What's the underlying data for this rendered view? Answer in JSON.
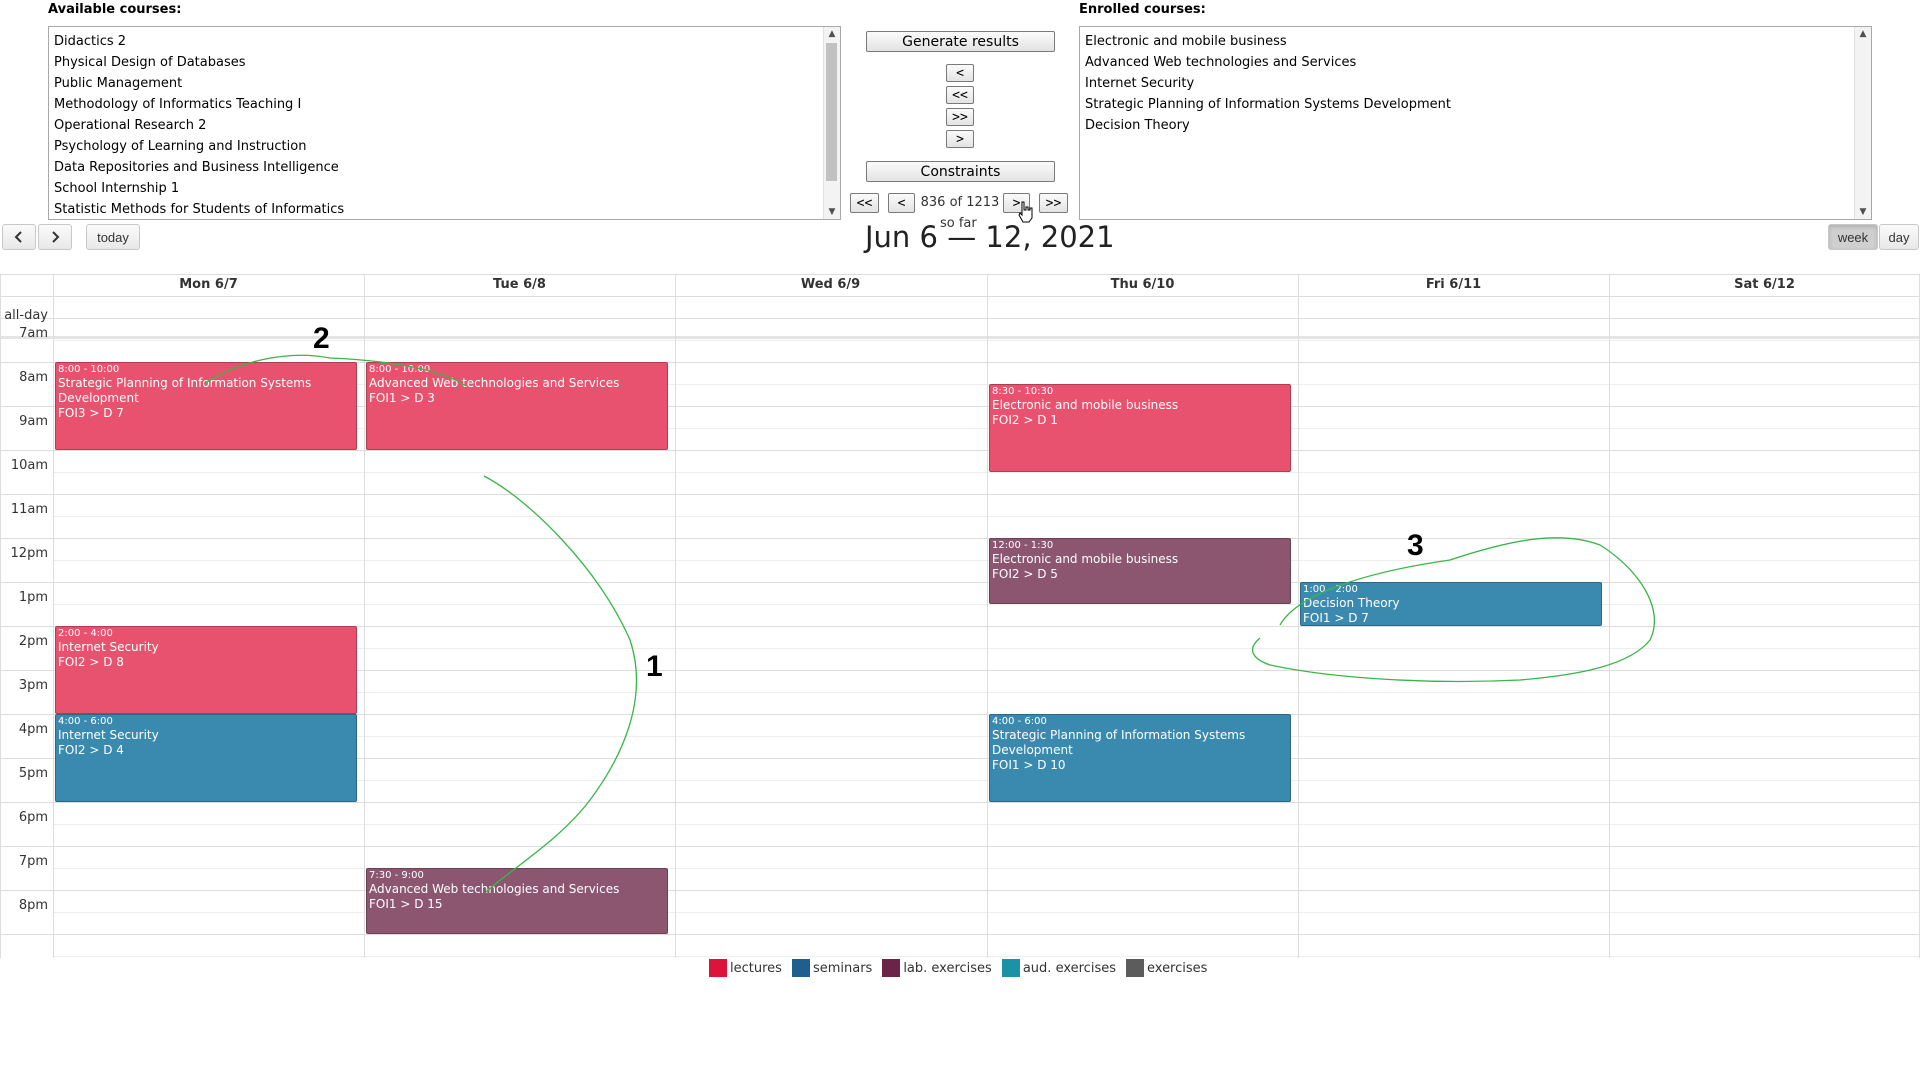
{
  "available": {
    "label": "Available courses:",
    "items": [
      "Didactics 2",
      "Physical Design of Databases",
      "Public Management",
      "Methodology of Informatics Teaching I",
      "Operational Research 2",
      "Psychology of Learning and Instruction",
      "Data Repositories and Business Intelligence",
      "School Internship 1",
      "Statistic Methods for Students of Informatics"
    ]
  },
  "enrolled": {
    "label": "Enrolled courses:",
    "items": [
      "Electronic and mobile business",
      "Advanced Web technologies and Services",
      "Internet Security",
      "Strategic Planning of Information Systems Development",
      "Decision Theory"
    ]
  },
  "controls": {
    "generate": "Generate results",
    "move_left": "<",
    "move_all_left": "<<",
    "move_all_right": ">>",
    "move_right": ">",
    "constraints": "Constraints",
    "first": "<<",
    "prev": "<",
    "counter": "836 of 1213",
    "next": ">",
    "last": ">>",
    "so_far": "so far"
  },
  "toolbar": {
    "prev": "<",
    "next": ">",
    "today": "today",
    "title": "Jun 6 — 12, 2021",
    "week": "week",
    "day": "day"
  },
  "calendar": {
    "days": [
      "Mon 6/7",
      "Tue 6/8",
      "Wed 6/9",
      "Thu 6/10",
      "Fri 6/11",
      "Sat 6/12"
    ],
    "allday": "all-day",
    "times": [
      "7am",
      "8am",
      "9am",
      "10am",
      "11am",
      "12pm",
      "1pm",
      "2pm",
      "3pm",
      "4pm",
      "5pm",
      "6pm",
      "7pm",
      "8pm"
    ],
    "events": [
      {
        "day": 0,
        "start": 8,
        "end": 10,
        "time": "8:00 - 10:00",
        "title": "Strategic Planning of Information Systems Development",
        "room": "FOI3 > D 7",
        "kind": "lectures"
      },
      {
        "day": 1,
        "start": 8,
        "end": 10,
        "time": "8:00 - 10:00",
        "title": "Advanced Web technologies and Services",
        "room": "FOI1 > D 3",
        "kind": "lectures"
      },
      {
        "day": 3,
        "start": 8.5,
        "end": 10.5,
        "time": "8:30 - 10:30",
        "title": "Electronic and mobile business",
        "room": "FOI2 > D 1",
        "kind": "lectures"
      },
      {
        "day": 3,
        "start": 12,
        "end": 13.5,
        "time": "12:00 - 1:30",
        "title": "Electronic and mobile business",
        "room": "FOI2 > D 5",
        "kind": "lab"
      },
      {
        "day": 4,
        "start": 13,
        "end": 14,
        "time": "1:00 - 2:00",
        "title": "Decision Theory",
        "room": "FOI1 > D 7",
        "kind": "seminars"
      },
      {
        "day": 0,
        "start": 14,
        "end": 16,
        "time": "2:00 - 4:00",
        "title": "Internet Security",
        "room": "FOI2 > D 8",
        "kind": "lectures"
      },
      {
        "day": 0,
        "start": 16,
        "end": 18,
        "time": "4:00 - 6:00",
        "title": "Internet Security",
        "room": "FOI2 > D 4",
        "kind": "seminars"
      },
      {
        "day": 3,
        "start": 16,
        "end": 18,
        "time": "4:00 - 6:00",
        "title": "Strategic Planning of Information Systems Development",
        "room": "FOI1 > D 10",
        "kind": "seminars"
      },
      {
        "day": 1,
        "start": 19.5,
        "end": 21,
        "time": "7:30 - 9:00",
        "title": "Advanced Web technologies and Services",
        "room": "FOI1 > D 15",
        "kind": "lab"
      }
    ]
  },
  "annotations": [
    "1",
    "2",
    "3"
  ],
  "legend": [
    {
      "label": "lectures",
      "color": "#dc143c"
    },
    {
      "label": "seminars",
      "color": "#1f5f8f"
    },
    {
      "label": "lab. exercises",
      "color": "#6b2447"
    },
    {
      "label": "aud. exercises",
      "color": "#1a93a6"
    },
    {
      "label": "exercises",
      "color": "#5c5c5c"
    }
  ],
  "colors": {
    "lectures": "#e8526e",
    "seminars": "#3a8ab0",
    "lab": "#8c5670",
    "annotation": "#3ab54a"
  }
}
